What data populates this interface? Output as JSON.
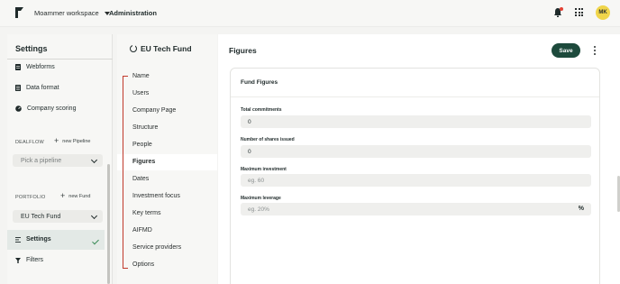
{
  "topbar": {
    "workspace": "Moammer workspace",
    "section": "Administration",
    "avatar_initials": "MK"
  },
  "settings_panel": {
    "title": "Settings",
    "items": [
      {
        "label": "Webforms",
        "icon": "webform-icon"
      },
      {
        "label": "Data format",
        "icon": "data-format-icon"
      },
      {
        "label": "Company scoring",
        "icon": "gauge-icon"
      }
    ],
    "dealflow": {
      "label": "DEALFLOW",
      "new_label": "new Pipeline",
      "select_placeholder": "Pick a pipeline"
    },
    "portfolio": {
      "label": "PORTFOLIO",
      "new_label": "new Fund",
      "select_value": "EU Tech Fund"
    },
    "bottom_items": [
      {
        "label": "Settings",
        "icon": "list-icon",
        "active": true
      },
      {
        "label": "Filters",
        "icon": "filter-icon",
        "active": false
      }
    ]
  },
  "fund_nav": {
    "title": "EU Tech Fund",
    "items": [
      "Name",
      "Users",
      "Company Page",
      "Structure",
      "People",
      "Figures",
      "Dates",
      "Investment focus",
      "Key terms",
      "AIFMD",
      "Service providers",
      "Options"
    ],
    "active": "Figures"
  },
  "main": {
    "title": "Figures",
    "save_label": "Save",
    "card_title": "Fund Figures",
    "fields": [
      {
        "label": "Total commitments",
        "value": "0",
        "placeholder": ""
      },
      {
        "label": "Number of shares issued",
        "value": "0",
        "placeholder": ""
      },
      {
        "label": "Maximum investment",
        "value": "",
        "placeholder": "eg. 60"
      },
      {
        "label": "Maximum leverage",
        "value": "",
        "placeholder": "eg. 20%",
        "suffix": "%"
      }
    ]
  },
  "colors": {
    "accent": "#1d4a3c",
    "bracket": "#c0392b",
    "check": "#3a8c57",
    "avatar": "#f0d54a"
  }
}
